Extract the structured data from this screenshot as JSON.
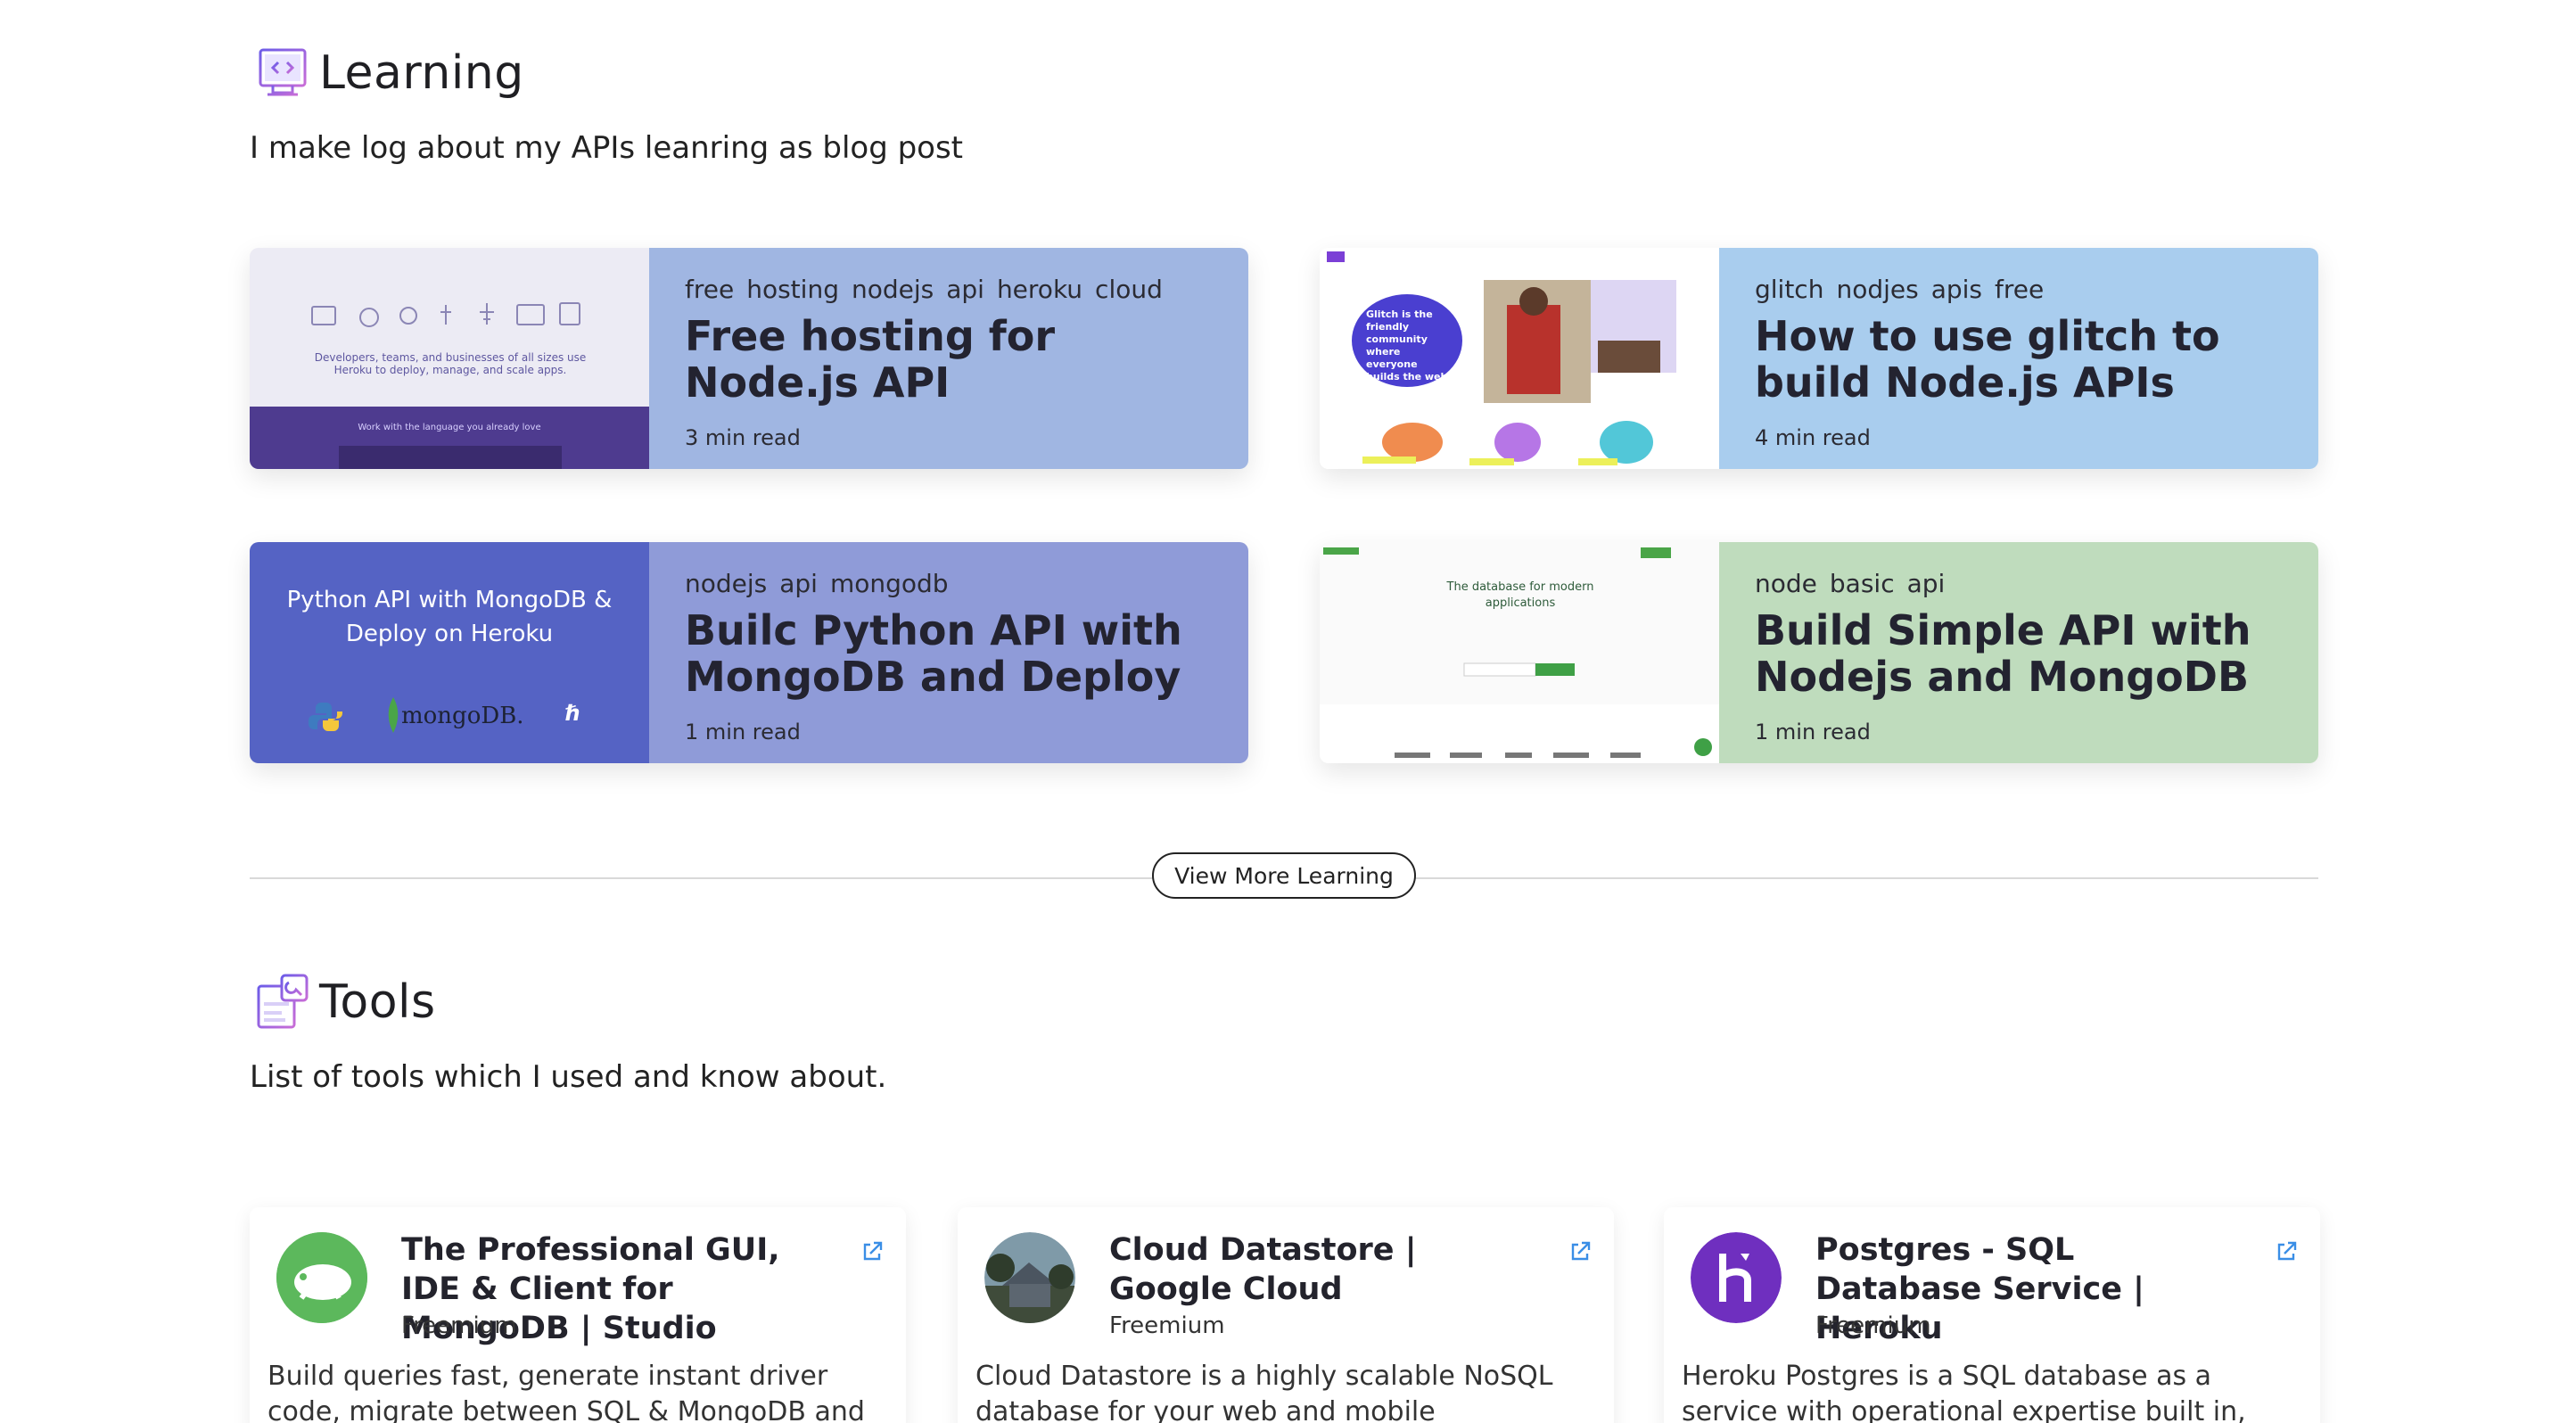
{
  "learning": {
    "title": "Learning",
    "description": "I make log about my APIs leanring as blog post",
    "icon": "code-monitor-icon",
    "view_more_label": "View More Learning",
    "cards": [
      {
        "tags": [
          "free",
          "hosting",
          "nodejs",
          "api",
          "heroku",
          "cloud"
        ],
        "title": "Free hosting for Node.js API applications",
        "read_time": "3 min read",
        "bg": "#a0b6e2",
        "thumb_caption": "Developers, teams, and businesses of all sizes use Heroku to deploy, manage, and scale apps.",
        "thumb_footer": "Work with the language you already love"
      },
      {
        "tags": [
          "glitch",
          "nodjes",
          "apis",
          "free"
        ],
        "title": "How to use glitch to build Node.js APIs",
        "read_time": "4 min read",
        "bg": "#a9cdee",
        "thumb_caption": "Glitch is the friendly community where everyone builds the web"
      },
      {
        "tags": [
          "nodejs",
          "api",
          "mongodb"
        ],
        "title": "Builc Python API with MongoDB and Deploy on",
        "read_time": "1 min read",
        "bg": "#8f9bd8",
        "thumb_caption": "Python API with MongoDB & Deploy on Heroku",
        "thumb_brand": "mongoDB."
      },
      {
        "tags": [
          "node",
          "basic",
          "api"
        ],
        "title": "Build Simple API with Nodejs and MongoDB",
        "read_time": "1 min read",
        "bg": "#bfdcbd",
        "thumb_caption": "The database for modern applications"
      }
    ]
  },
  "tools": {
    "title": "Tools",
    "description": "List of tools which I used and know about.",
    "icon": "tools-window-icon",
    "items": [
      {
        "title": "The Professional GUI, IDE & Client for MongoDB | Studio",
        "tier": "Freemium",
        "description": "Build queries fast, generate instant driver code, migrate between SQL & MongoDB and much",
        "logo": "studio3t-icon",
        "logo_color": "#5cb85c"
      },
      {
        "title": "Cloud Datastore | Google Cloud",
        "tier": "Freemium",
        "description": "Cloud Datastore is a highly scalable NoSQL database for your web and mobile applications.",
        "logo": "house-photo-icon",
        "logo_color": "#3d4a52"
      },
      {
        "title": "Postgres - SQL Database Service | Heroku",
        "tier": "Freemium",
        "description": "Heroku Postgres is a SQL database as a service with operational expertise built in, easy setup,",
        "logo": "heroku-icon",
        "logo_color": "#6f2fbf"
      }
    ]
  }
}
